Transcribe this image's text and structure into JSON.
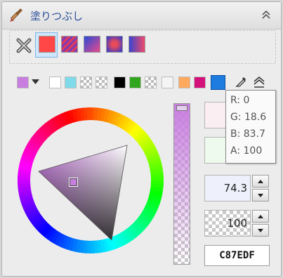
{
  "panel": {
    "title": "塗りつぶし"
  },
  "fill_modes": [
    {
      "name": "none"
    },
    {
      "name": "solid",
      "color": "#ff4747"
    },
    {
      "name": "pattern"
    },
    {
      "name": "linear-gradient"
    },
    {
      "name": "radial-gradient"
    },
    {
      "name": "mesh-gradient"
    }
  ],
  "current_color": "#c87edf",
  "palette": [
    "#ffffff",
    "#7fdbe9",
    "checker",
    "checker",
    "#000000",
    "#32a51e",
    "checker",
    "#f5f5f5",
    "#ffa95e",
    "#d4117a",
    "#1e7be0"
  ],
  "tooltip": {
    "r": "R: 0",
    "g": "G: 18.6",
    "b": "B: 83.7",
    "a": "A: 100"
  },
  "values": {
    "lightness": "74.3",
    "alpha": "100"
  },
  "hex": "C87EDF"
}
